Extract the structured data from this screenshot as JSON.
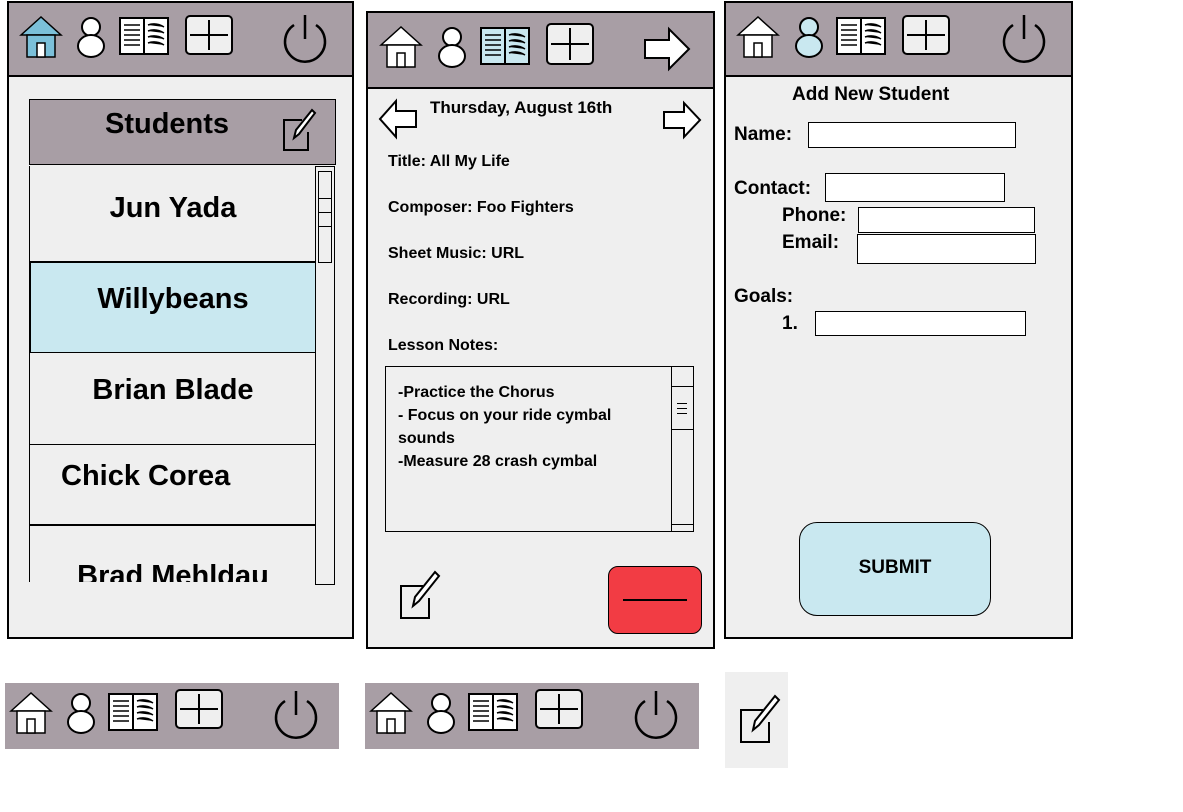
{
  "colors": {
    "navbar": "#a89ea5",
    "panel": "#efefef",
    "selected": "#c9e8f0",
    "home_roof": "#7bc0d9",
    "delete_button": "#f23c44",
    "submit_button": "#c9e8f0"
  },
  "icons": {
    "nav": [
      "home-icon",
      "user-icon",
      "book-icon",
      "add-icon",
      "power-icon"
    ],
    "lesson_nav": [
      "home-icon",
      "user-icon",
      "book-icon",
      "add-icon",
      "forward-arrow-icon"
    ],
    "edit": "edit-icon"
  },
  "students_screen": {
    "title": "Students",
    "students": [
      {
        "name": "Jun Yada",
        "selected": false
      },
      {
        "name": "Willybeans",
        "selected": true
      },
      {
        "name": "Brian Blade",
        "selected": false
      },
      {
        "name": "Chick Corea",
        "selected": false
      },
      {
        "name": "Brad Mehldau",
        "selected": false
      }
    ]
  },
  "lesson_screen": {
    "date": "Thursday, August 16th",
    "title_line": "Title: All My  Life",
    "composer_line": "Composer: Foo Fighters",
    "sheet_music_line": "Sheet Music: URL",
    "recording_line": "Recording: URL",
    "lesson_notes_label": "Lesson Notes:",
    "notes": [
      "-Practice the Chorus",
      "- Focus on your ride cymbal",
      "sounds",
      "-Measure 28 crash cymbal"
    ]
  },
  "add_student_screen": {
    "title": "Add New Student",
    "name_label": "Name:",
    "contact_label": "Contact:",
    "phone_label": "Phone:",
    "email_label": "Email:",
    "goals_label": "Goals:",
    "goal_number": "1.",
    "submit_label": "SUBMIT",
    "fields": {
      "name": "",
      "contact": "",
      "phone": "",
      "email": "",
      "goal_1": ""
    }
  }
}
